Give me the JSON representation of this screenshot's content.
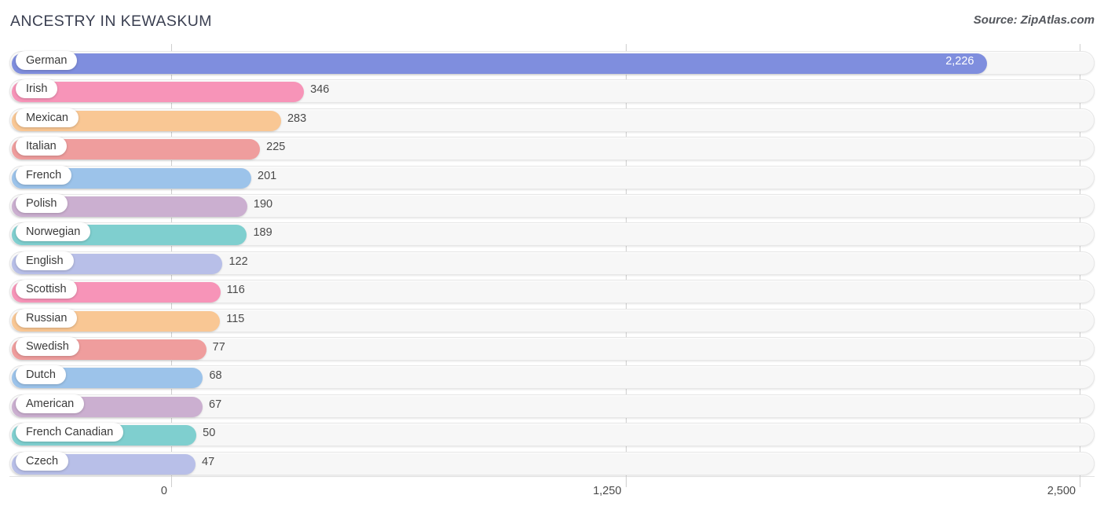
{
  "header": {
    "title": "ANCESTRY IN KEWASKUM",
    "source": "Source: ZipAtlas.com"
  },
  "chart_data": {
    "type": "bar",
    "orientation": "horizontal",
    "title": "ANCESTRY IN KEWASKUM",
    "subtitle": "",
    "xlabel": "",
    "ylabel": "",
    "xlim": [
      0,
      2500
    ],
    "grid": true,
    "legend_position": "none",
    "axis_ticks": [
      "0",
      "1,250",
      "2,500"
    ],
    "axis_tick_values": [
      0,
      1250,
      2500
    ],
    "categories": [
      "German",
      "Irish",
      "Mexican",
      "Italian",
      "French",
      "Polish",
      "Norwegian",
      "English",
      "Scottish",
      "Russian",
      "Swedish",
      "Dutch",
      "American",
      "French Canadian",
      "Czech"
    ],
    "values": [
      2226,
      346,
      283,
      225,
      201,
      190,
      189,
      122,
      116,
      115,
      77,
      68,
      67,
      50,
      47
    ],
    "value_labels": [
      "2,226",
      "346",
      "283",
      "225",
      "201",
      "190",
      "189",
      "122",
      "116",
      "115",
      "77",
      "68",
      "67",
      "50",
      "47"
    ],
    "colors": [
      "#7f8ede",
      "#f794b8",
      "#f9c794",
      "#ef9d9d",
      "#9cc3ea",
      "#cbafd0",
      "#7fcfcf",
      "#b8bfe8",
      "#f794b8",
      "#f9c794",
      "#ef9d9d",
      "#9cc3ea",
      "#cbafd0",
      "#7fcfcf",
      "#b8bfe8"
    ]
  },
  "style": {
    "track_bg": "#f7f7f7",
    "track_border": "#e7e7e7",
    "gridline": "#cfcfcf",
    "title_color": "#3a3f51",
    "label_color": "#3b3b3b",
    "value_color": "#4a4a4a",
    "value_inside_color": "#ffffff"
  }
}
